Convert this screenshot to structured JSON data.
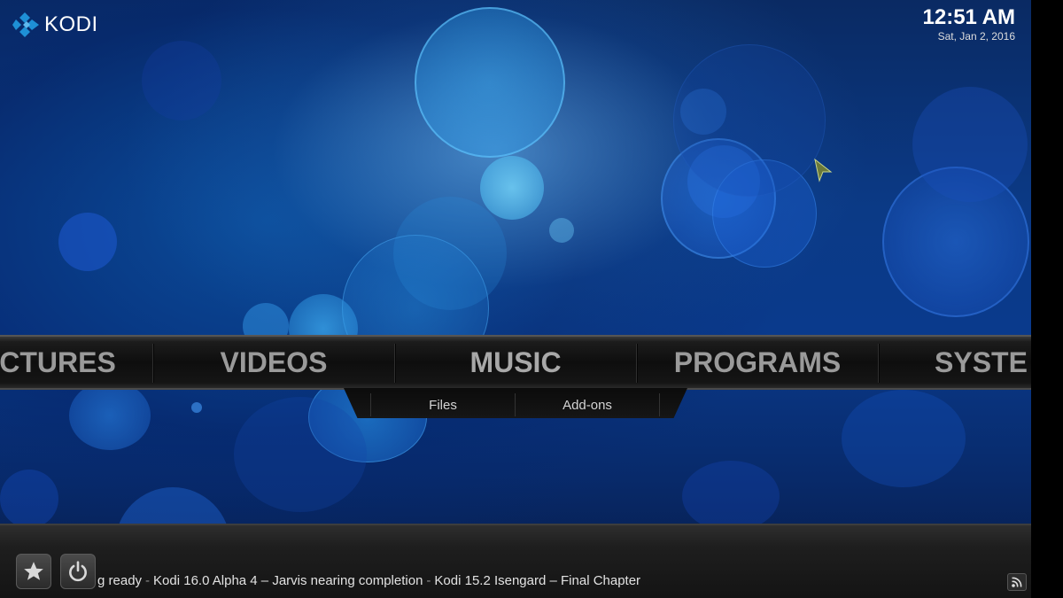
{
  "app": {
    "logo_text": "KODI"
  },
  "clock": {
    "time": "12:51 AM",
    "date": "Sat, Jan 2, 2016"
  },
  "main_menu": {
    "items": [
      {
        "label": "CTURES"
      },
      {
        "label": "VIDEOS"
      },
      {
        "label": "MUSIC"
      },
      {
        "label": "PROGRAMS"
      },
      {
        "label": "SYSTE"
      }
    ],
    "active": "MUSIC"
  },
  "submenu": {
    "items": [
      {
        "label": "Files"
      },
      {
        "label": "Add-ons"
      }
    ]
  },
  "footer": {
    "favourites_icon": "star-icon",
    "power_icon": "power-icon",
    "rss_icon": "rss-icon",
    "ticker": {
      "items": [
        "g ready",
        "Kodi 16.0 Alpha 4 – Jarvis nearing completion",
        "Kodi 15.2 Isengard – Final Chapter"
      ],
      "separator": "-"
    }
  },
  "colors": {
    "background_primary": "#0b3a86",
    "menu_text": "#9a9a9a",
    "logo_blue": "#1e90d6"
  }
}
